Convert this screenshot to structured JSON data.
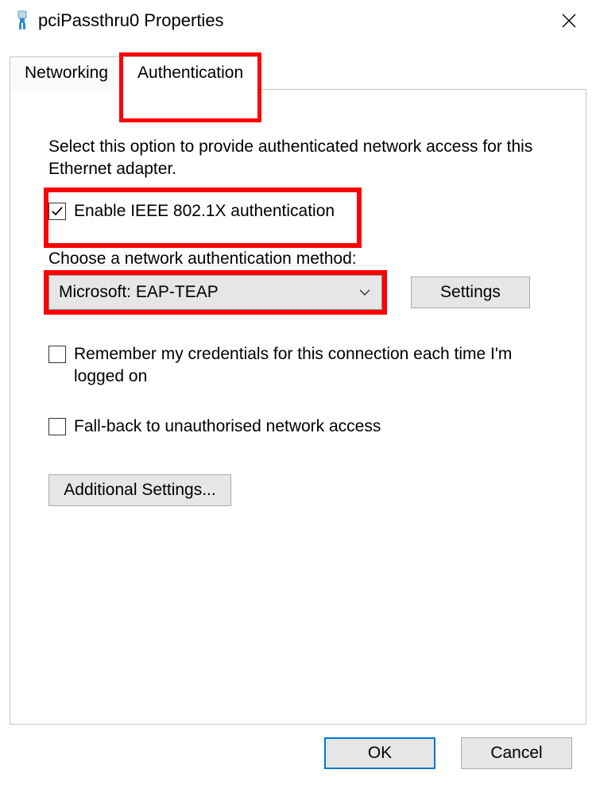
{
  "title": "pciPassthru0 Properties",
  "tabs": {
    "networking": "Networking",
    "authentication": "Authentication"
  },
  "description": "Select this option to provide authenticated network access for this Ethernet adapter.",
  "enable_label": "Enable IEEE 802.1X authentication",
  "choose_label": "Choose a network authentication method:",
  "method_selected": "Microsoft: EAP-TEAP",
  "settings_btn": "Settings",
  "remember_label": "Remember my credentials for this connection each time I'm logged on",
  "fallback_label": "Fall-back to unauthorised network access",
  "additional_btn": "Additional Settings...",
  "ok_btn": "OK",
  "cancel_btn": "Cancel"
}
